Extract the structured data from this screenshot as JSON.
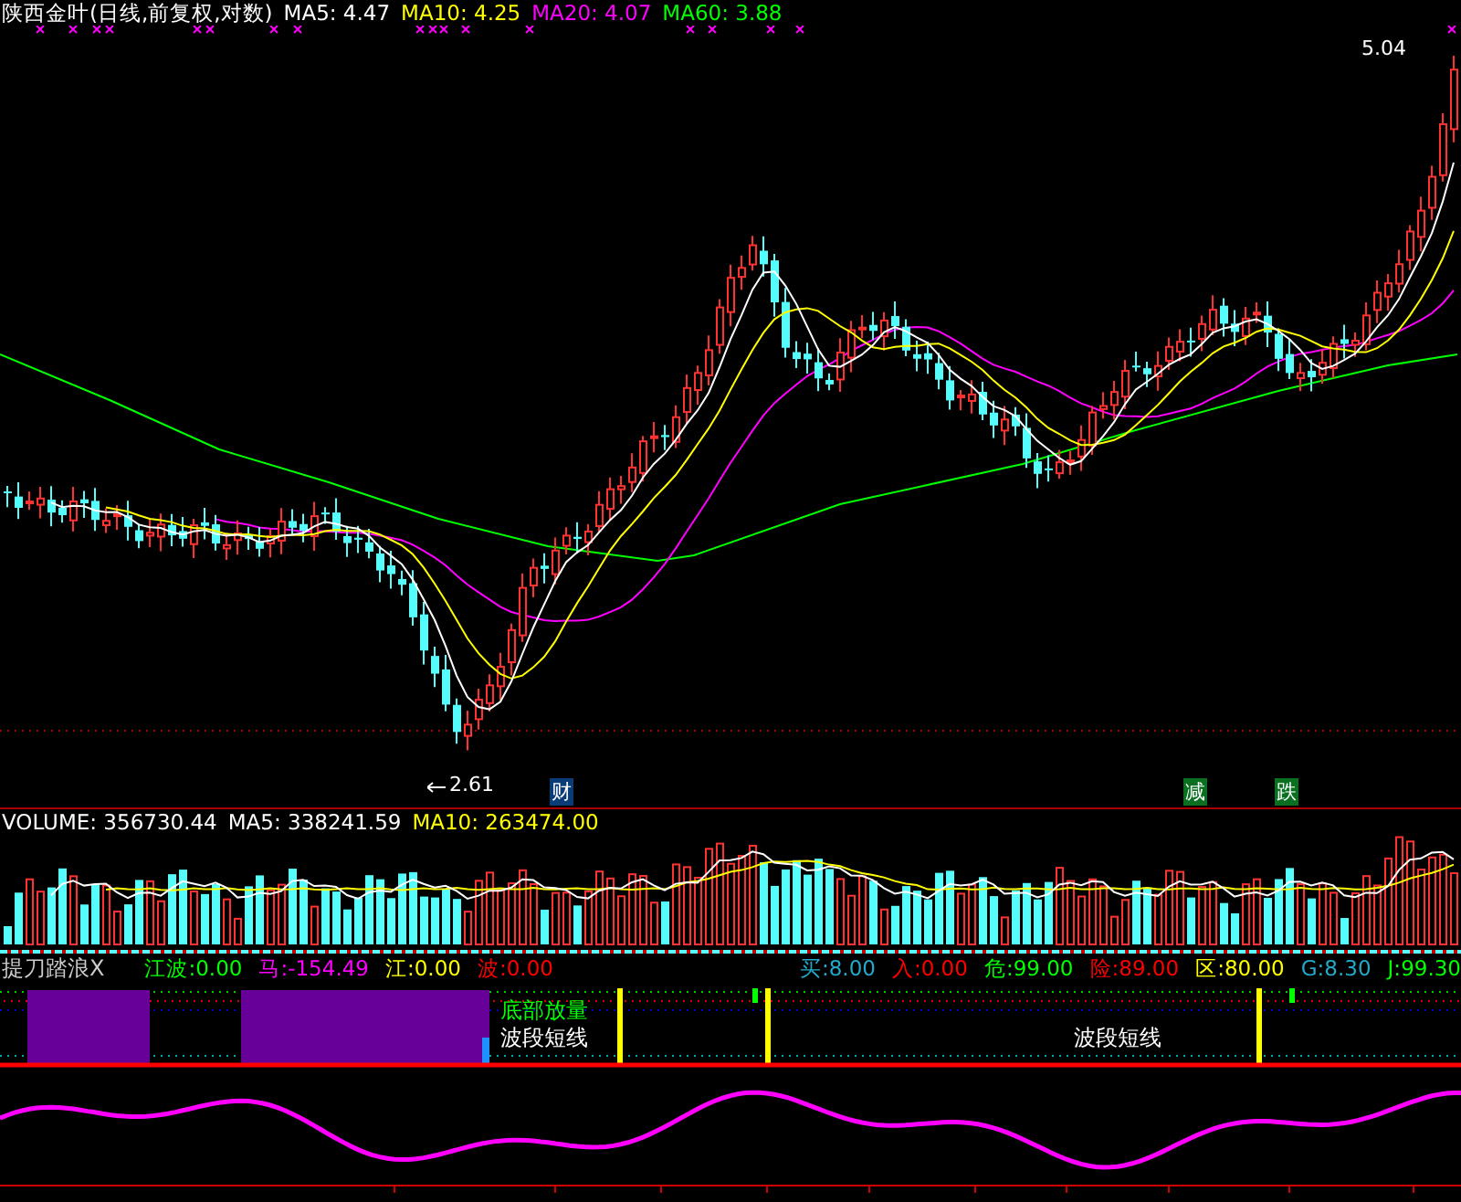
{
  "header": {
    "title": "陕西金叶(日线,前复权,对数)",
    "ma": [
      {
        "label": "MA5: 4.47",
        "color": "#ffffff"
      },
      {
        "label": "MA10: 4.25",
        "color": "#ffff00"
      },
      {
        "label": "MA20: 4.07",
        "color": "#ff00ff"
      },
      {
        "label": "MA60: 3.88",
        "color": "#00ff00"
      }
    ]
  },
  "price_chart": {
    "high_label": "5.04",
    "low_label": "2.61",
    "events": [
      {
        "label": "财",
        "color": "#0a3c78"
      },
      {
        "label": "减",
        "color": "#0a7020"
      },
      {
        "label": "跌",
        "color": "#0a7020"
      }
    ]
  },
  "volume": {
    "items": [
      {
        "label": "VOLUME: 356730.44",
        "color": "#ffffff"
      },
      {
        "label": "MA5: 338241.59",
        "color": "#ffffff"
      },
      {
        "label": "MA10: 263474.00",
        "color": "#ffff00"
      }
    ]
  },
  "indicator": {
    "title": "提刀踏浪X",
    "left_values": [
      {
        "label": "江波:",
        "value": "0.00",
        "color": "#00ff00"
      },
      {
        "label": "马:",
        "value": "-154.49",
        "color": "#ff00ff"
      },
      {
        "label": "江:",
        "value": "0.00",
        "color": "#ffff00"
      },
      {
        "label": "波:",
        "value": "0.00",
        "color": "#ff0000"
      }
    ],
    "right_values": [
      {
        "label": "买:",
        "value": "8.00",
        "color": "#22aacc"
      },
      {
        "label": "入:",
        "value": "0.00",
        "color": "#ff0000"
      },
      {
        "label": "危:",
        "value": "99.00",
        "color": "#00ff00"
      },
      {
        "label": "险:",
        "value": "89.00",
        "color": "#ff0000"
      },
      {
        "label": "区:",
        "value": "80.00",
        "color": "#ffff00"
      },
      {
        "label": "G:",
        "value": "8.30",
        "color": "#22aacc"
      },
      {
        "label": "J:",
        "value": "99.30",
        "color": "#00ff00"
      }
    ]
  },
  "signals": [
    {
      "label": "底部放量",
      "kind": "volume"
    },
    {
      "label": "波段短线",
      "kind": "wave"
    },
    {
      "label": "波段短线",
      "kind": "wave"
    }
  ]
}
